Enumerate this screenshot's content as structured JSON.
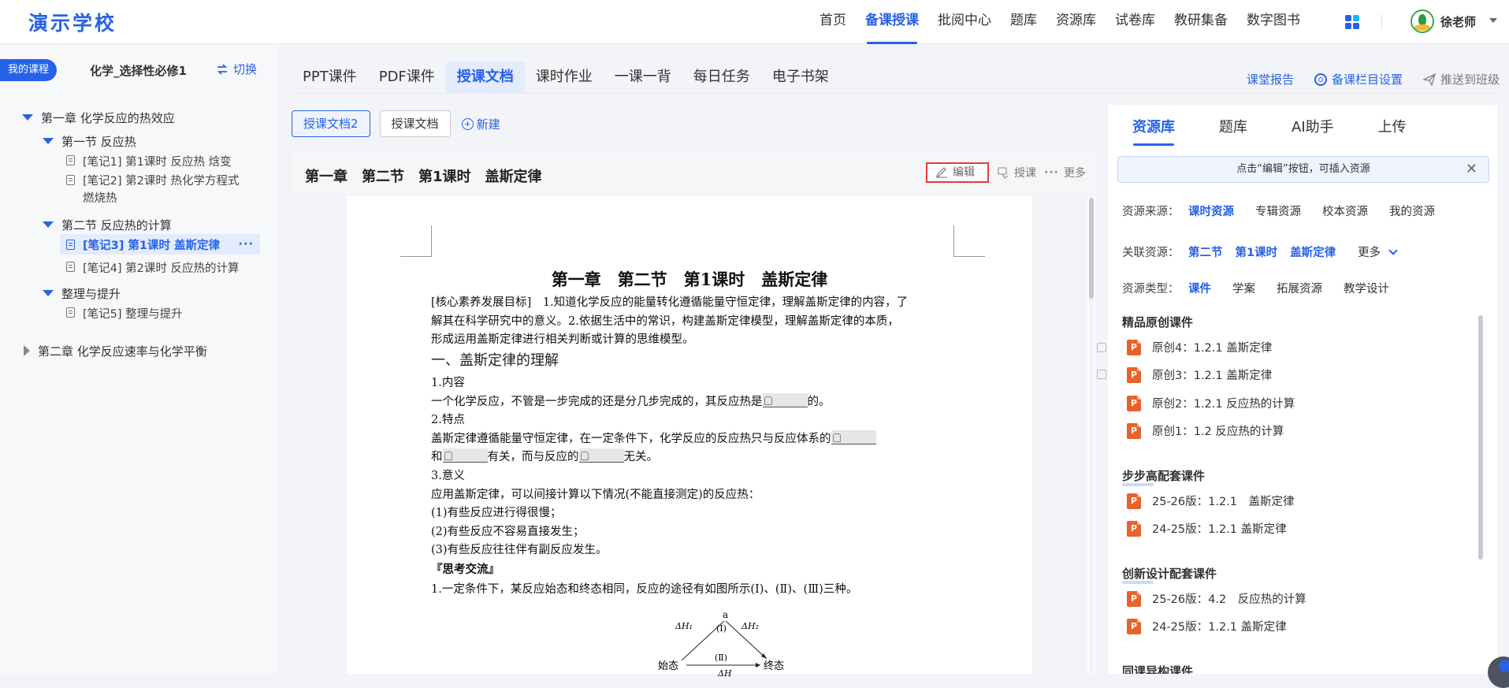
{
  "app": {
    "logo": "演示学校"
  },
  "topnav": {
    "items": [
      "首页",
      "备课授课",
      "批阅中心",
      "题库",
      "资源库",
      "试卷库",
      "教研集备",
      "数字图书"
    ],
    "active_index": 1,
    "user_name": "徐老师"
  },
  "left": {
    "my_course": "我的课程",
    "course_name": "化学_选择性必修1",
    "switch_label": "切换",
    "tree": {
      "ch1": "第一章 化学反应的热效应",
      "sec1": "第一节 反应热",
      "note1": "[笔记1] 第1课时 反应热 焓变",
      "note2_line1": "[笔记2] 第2课时 热化学方程式",
      "note2_line2": "燃烧热",
      "sec2": "第二节 反应热的计算",
      "note3": "[笔记3] 第1课时 盖斯定律",
      "note3_more": "···",
      "note4": "[笔记4] 第2课时 反应热的计算",
      "sec3": "整理与提升",
      "note5": "[笔记5] 整理与提升",
      "ch2": "第二章 化学反应速率与化学平衡"
    }
  },
  "tabs": {
    "items": [
      "PPT课件",
      "PDF课件",
      "授课文档",
      "课时作业",
      "一课一背",
      "每日任务",
      "电子书架"
    ],
    "active_index": 2,
    "report": "课堂报告",
    "settings": "备课栏目设置",
    "push": "推送到班级"
  },
  "doctabs": {
    "items": [
      "授课文档2",
      "授课文档"
    ],
    "active_index": 0,
    "new_label": "新建"
  },
  "doc": {
    "header_title": "第一章　第二节　第1课时　盖斯定律",
    "edit_label": "编辑",
    "teach_label": "授课",
    "more_label": "更多",
    "paper_title": "第一章　第二节　第1课时　盖斯定律",
    "goal_line1": "[核心素养发展目标]　1.知道化学反应的能量转化遵循能量守恒定律，理解盖斯定律的内容，了",
    "goal_line2": "解其在科学研究中的意义。2.依据生活中的常识，构建盖斯定律模型，理解盖斯定律的本质，",
    "goal_line3": "形成运用盖斯定律进行相关判断或计算的思维模型。",
    "h1": "一、盖斯定律的理解",
    "s1": "1.内容",
    "s1_text_a": "一个化学反应，不管是一步完成的还是分几步完成的，其反应热是",
    "s1_text_b": "的。",
    "s2": "2.特点",
    "s2_text_a": "盖斯定律遵循能量守恒定律，在一定条件下，化学反应的反应热只与反应体系的",
    "s2_text_b": "和",
    "s2_text_c": "有关，而与反应的",
    "s2_text_d": "无关。",
    "s3": "3.意义",
    "s3_text": "应用盖斯定律，可以间接计算以下情况(不能直接测定)的反应热：",
    "s3_i1": "(1)有些反应进行得很慢；",
    "s3_i2": "(2)有些反应不容易直接发生；",
    "s3_i3": "(3)有些反应往往伴有副反应发生。",
    "think": "『思考交流』",
    "q1": "1.一定条件下，某反应始态和终态相同，反应的途径有如图所示(Ⅰ)、(Ⅱ)、(Ⅲ)三种。",
    "diagram": {
      "a": "a",
      "route1": "(Ⅰ)",
      "route2": "(Ⅱ)",
      "dh1": "ΔH₁",
      "dh2": "ΔH₂",
      "dh": "ΔH",
      "start": "始态",
      "end": "终态"
    }
  },
  "right": {
    "tabs": [
      "资源库",
      "题库",
      "AI助手",
      "上传"
    ],
    "active_index": 0,
    "hint": "点击“编辑”按钮，可插入资源",
    "source_label": "资源来源：",
    "sources": [
      "课时资源",
      "专辑资源",
      "校本资源",
      "我的资源"
    ],
    "related_label": "关联资源：",
    "related": [
      "第二节",
      "第1课时",
      "盖斯定律"
    ],
    "related_more": "更多",
    "type_label": "资源类型：",
    "types": [
      "课件",
      "学案",
      "拓展资源",
      "教学设计"
    ],
    "sections": [
      {
        "title": "精品原创课件",
        "items": [
          "原创4：1.2.1 盖斯定律",
          "原创3：1.2.1 盖斯定律",
          "原创2：1.2.1 反应热的计算",
          "原创1：1.2 反应热的计算"
        ]
      },
      {
        "title": "步步高配套课件",
        "items": [
          "25-26版：1.2.1　盖斯定律",
          "24-25版：1.2.1 盖斯定律"
        ]
      },
      {
        "title": "创新设计配套课件",
        "items": [
          "25-26版：4.2　反应热的计算",
          "24-25版：1.2.1 盖斯定律"
        ]
      },
      {
        "title": "同课异构课件",
        "items": []
      }
    ],
    "ppt_icon_letter": "P"
  },
  "colors": {
    "accent": "#2762e6",
    "edit_border": "#e63a3a",
    "ppt": "#e8632b"
  }
}
